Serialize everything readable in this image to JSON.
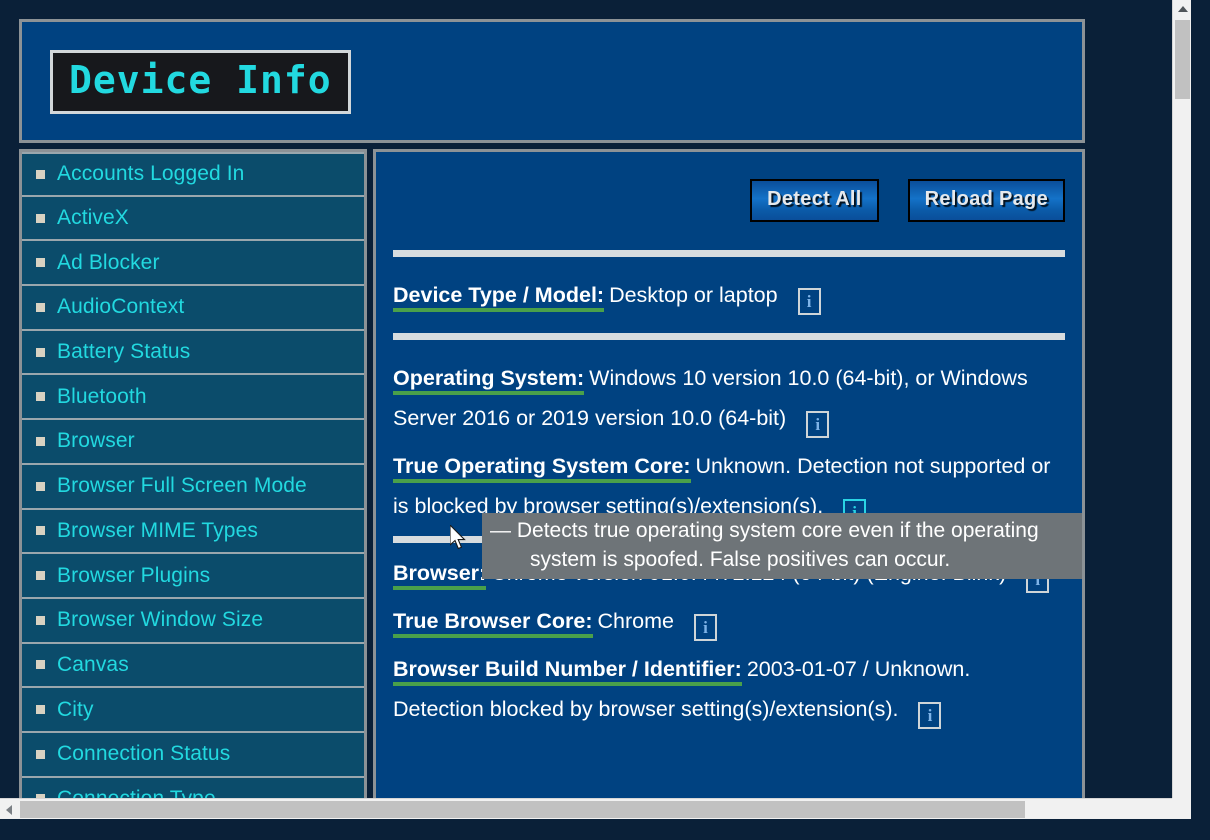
{
  "header": {
    "title": "Device Info"
  },
  "sidebar": {
    "items": [
      {
        "label": "Accounts Logged In"
      },
      {
        "label": "ActiveX"
      },
      {
        "label": "Ad Blocker"
      },
      {
        "label": "AudioContext"
      },
      {
        "label": "Battery Status"
      },
      {
        "label": "Bluetooth"
      },
      {
        "label": "Browser"
      },
      {
        "label": "Browser Full Screen Mode"
      },
      {
        "label": "Browser MIME Types"
      },
      {
        "label": "Browser Plugins"
      },
      {
        "label": "Browser Window Size"
      },
      {
        "label": "Canvas"
      },
      {
        "label": "City"
      },
      {
        "label": "Connection Status"
      },
      {
        "label": "Connection Type"
      }
    ]
  },
  "toolbar": {
    "detect_all_label": "Detect All",
    "reload_page_label": "Reload Page"
  },
  "main": {
    "rows": [
      {
        "label": "Device Type / Model:",
        "value": "Desktop or laptop",
        "info_icon": "i"
      },
      {
        "label": "Operating System:",
        "value": "Windows 10 version 10.0 (64-bit), or Windows Server 2016 or 2019 version 10.0 (64-bit)",
        "info_icon": "i"
      },
      {
        "label": "True Operating System Core:",
        "value": "Unknown. Detection not supported or is blocked by browser setting(s)/extension(s).",
        "info_icon": "i"
      },
      {
        "label": "Browser:",
        "value": "Chrome version 91.0.4472.124 (64-bit) (Engine: Blink)",
        "info_icon": "i"
      },
      {
        "label": "True Browser Core:",
        "value": "Chrome",
        "info_icon": "i"
      },
      {
        "label": "Browser Build Number / Identifier:",
        "value": "2003-01-07 / Unknown. Detection blocked by browser setting(s)/extension(s).",
        "info_icon": "i"
      }
    ]
  },
  "tooltip": {
    "dash": "—",
    "line1": "Detects true operating system core even if the operating",
    "line2": "system is spoofed. False positives can occur."
  },
  "colors": {
    "page_background": "#0a2038",
    "header_panel": "#004281",
    "sidebar_panel": "#0b4c6b",
    "main_panel": "#004281",
    "accent_cyan": "#22d9e0",
    "label_underline_green": "#4aa04a",
    "divider_gray": "#d7dcdf",
    "tooltip_background": "#6e7478",
    "panel_border": "#8c9296"
  }
}
